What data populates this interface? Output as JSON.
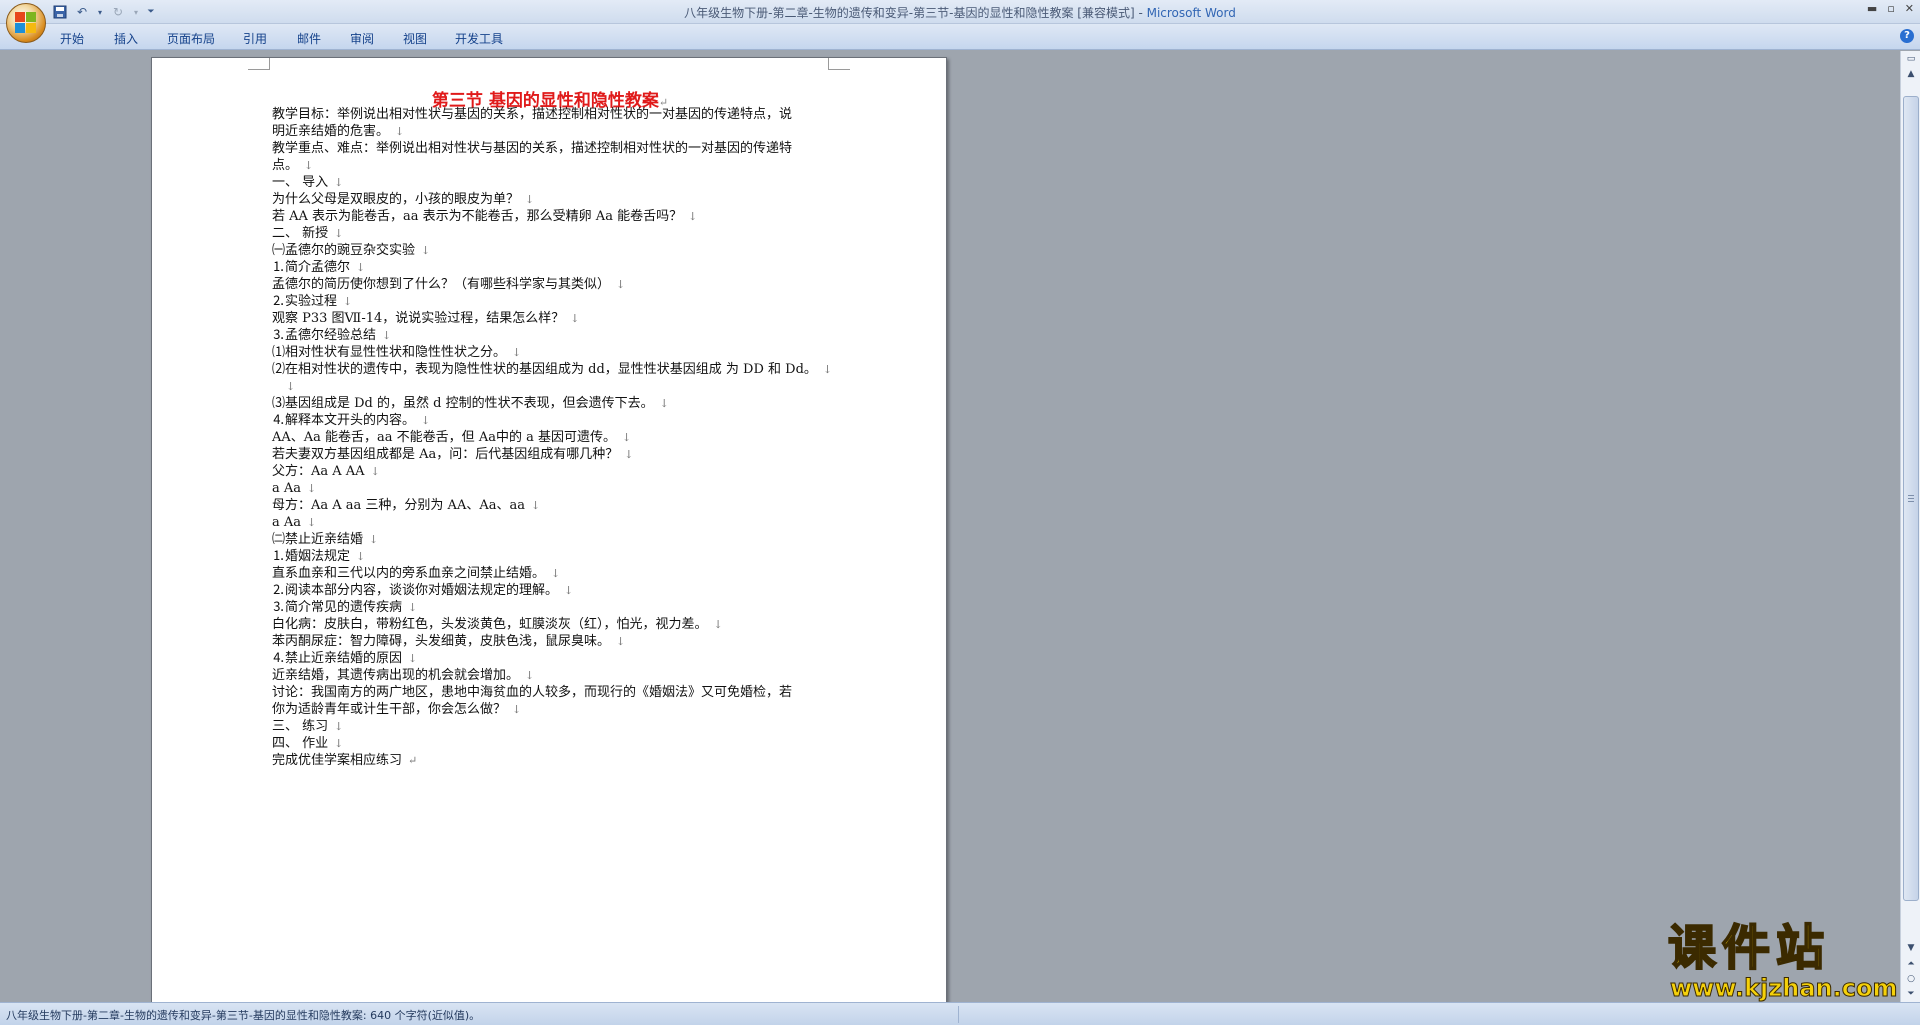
{
  "window": {
    "title": "八年级生物下册-第二章-生物的遗传和变异-第三节-基因的显性和隐性教案 [兼容模式] - ",
    "app_name": "Microsoft Word"
  },
  "ribbon": {
    "tabs": [
      "开始",
      "插入",
      "页面布局",
      "引用",
      "邮件",
      "审阅",
      "视图",
      "开发工具"
    ],
    "help": "?"
  },
  "document": {
    "title": "第三节  基因的显性和隐性教案",
    "lines": [
      "教学目标：举例说出相对性状与基因的关系，描述控制相对性状的一对基因的传递特点，说",
      "明近亲结婚的危害。",
      "教学重点、难点：举例说出相对性状与基因的关系，描述控制相对性状的一对基因的传递特",
      "点。",
      "一、 导入",
      "为什么父母是双眼皮的，小孩的眼皮为单？",
      "若 AA 表示为能卷舌，aa 表示为不能卷舌，那么受精卵 Aa 能卷舌吗？",
      "二、 新授",
      "㈠孟德尔的豌豆杂交实验",
      "⒈简介孟德尔",
      "孟德尔的简历使你想到了什么？（有哪些科学家与其类似）",
      "⒉实验过程",
      "观察 P33 图Ⅶ-14，说说实验过程，结果怎么样？",
      "⒊孟德尔经验总结",
      "⑴相对性状有显性性状和隐性性状之分。",
      "⑵在相对性状的遗传中，表现为隐性性状的基因组成为 dd，显性性状基因组成 为 DD 和 Dd。",
      "",
      "⑶基因组成是 Dd 的，虽然 d 控制的性状不表现，但会遗传下去。",
      "⒋解释本文开头的内容。",
      "AA、Aa 能卷舌，aa 不能卷舌，但 Aa中的 a 基因可遗传。",
      "若夫妻双方基因组成都是 Aa，问：后代基因组成有哪几种？",
      "父方：Aa A AA",
      "               a Aa",
      "母方：Aa A aa  三种，分别为 AA、Aa、aa",
      "               a Aa",
      "㈡禁止近亲结婚",
      "⒈婚姻法规定",
      "直系血亲和三代以内的旁系血亲之间禁止结婚。",
      "⒉阅读本部分内容，谈谈你对婚姻法规定的理解。",
      "⒊简介常见的遗传疾病",
      "白化病：皮肤白，带粉红色，头发淡黄色，虹膜淡灰（红），怕光，视力差。",
      "苯丙酮尿症：智力障碍，头发细黄，皮肤色浅，鼠尿臭味。",
      "⒋禁止近亲结婚的原因",
      "近亲结婚，其遗传病出现的机会就会增加。",
      "讨论：我国南方的两广地区，患地中海贫血的人较多，而现行的《婚姻法》又可免婚检，若",
      "你为适龄青年或计生干部，你会怎么做？",
      "三、 练习",
      "四、 作业",
      "完成优佳学案相应练习"
    ],
    "para_mark": "↓",
    "end_mark": "↵"
  },
  "statusbar": {
    "text": "八年级生物下册-第二章-生物的遗传和变异-第三节-基因的显性和隐性教案: 640 个字符(近似值)。"
  },
  "watermark": {
    "text": "课件站",
    "url": "www.kjzhan.com"
  }
}
